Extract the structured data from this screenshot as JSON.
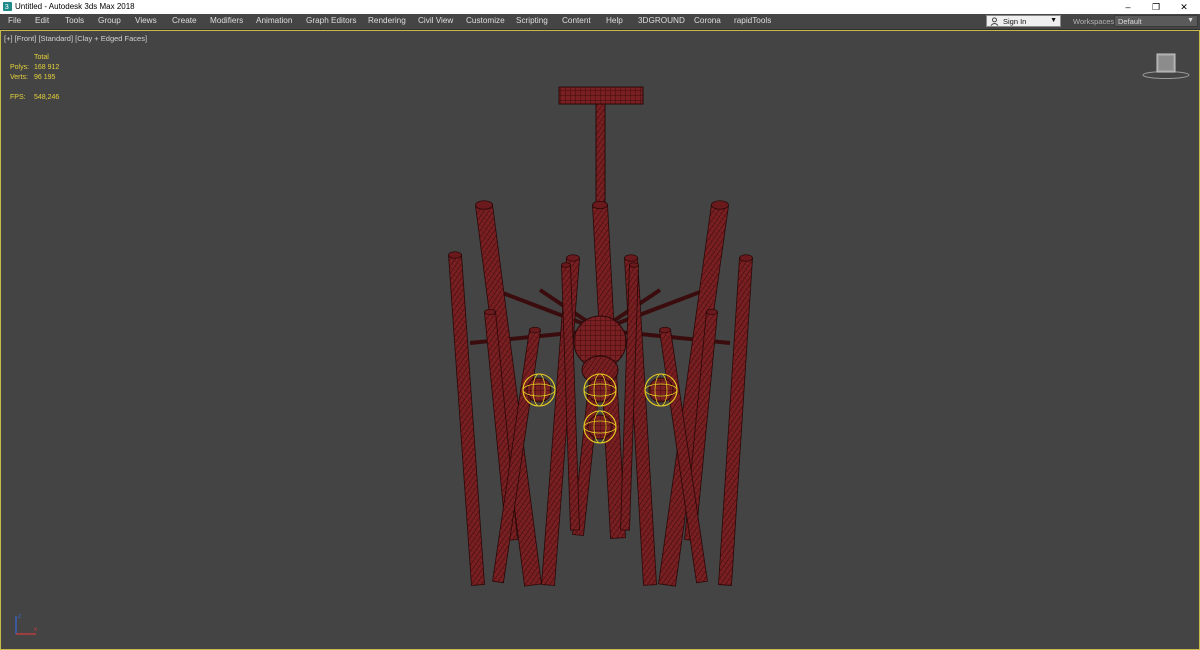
{
  "window": {
    "title": "Untitled - Autodesk 3ds Max 2018",
    "minimize": "–",
    "maximize": "❐",
    "close": "✕"
  },
  "menu": [
    "File",
    "Edit",
    "Tools",
    "Group",
    "Views",
    "Create",
    "Modifiers",
    "Animation",
    "Graph Editors",
    "Rendering",
    "Civil View",
    "Customize",
    "Scripting",
    "Content",
    "Help",
    "3DGROUND",
    "Corona",
    "rapidTools"
  ],
  "account": {
    "sign_in": "Sign In",
    "caret": "▼"
  },
  "workspaces": {
    "label": "Workspaces:",
    "value": "Default",
    "caret": "▼"
  },
  "viewport": {
    "labels": [
      "[+]",
      "[Front]",
      "[Standard]",
      "[Clay + Edged Faces]"
    ],
    "stats": {
      "header": "Total",
      "polys_label": "Polys:",
      "polys": "168 912",
      "verts_label": "Verts:",
      "verts": "96 195",
      "fps_label": "FPS:",
      "fps": "548,246"
    }
  },
  "colors": {
    "mesh": "#7a1f22",
    "wire": "#2a0808",
    "selection": "#e8d020",
    "viewport_bg": "#444444",
    "stats_text": "#e6d23a"
  }
}
